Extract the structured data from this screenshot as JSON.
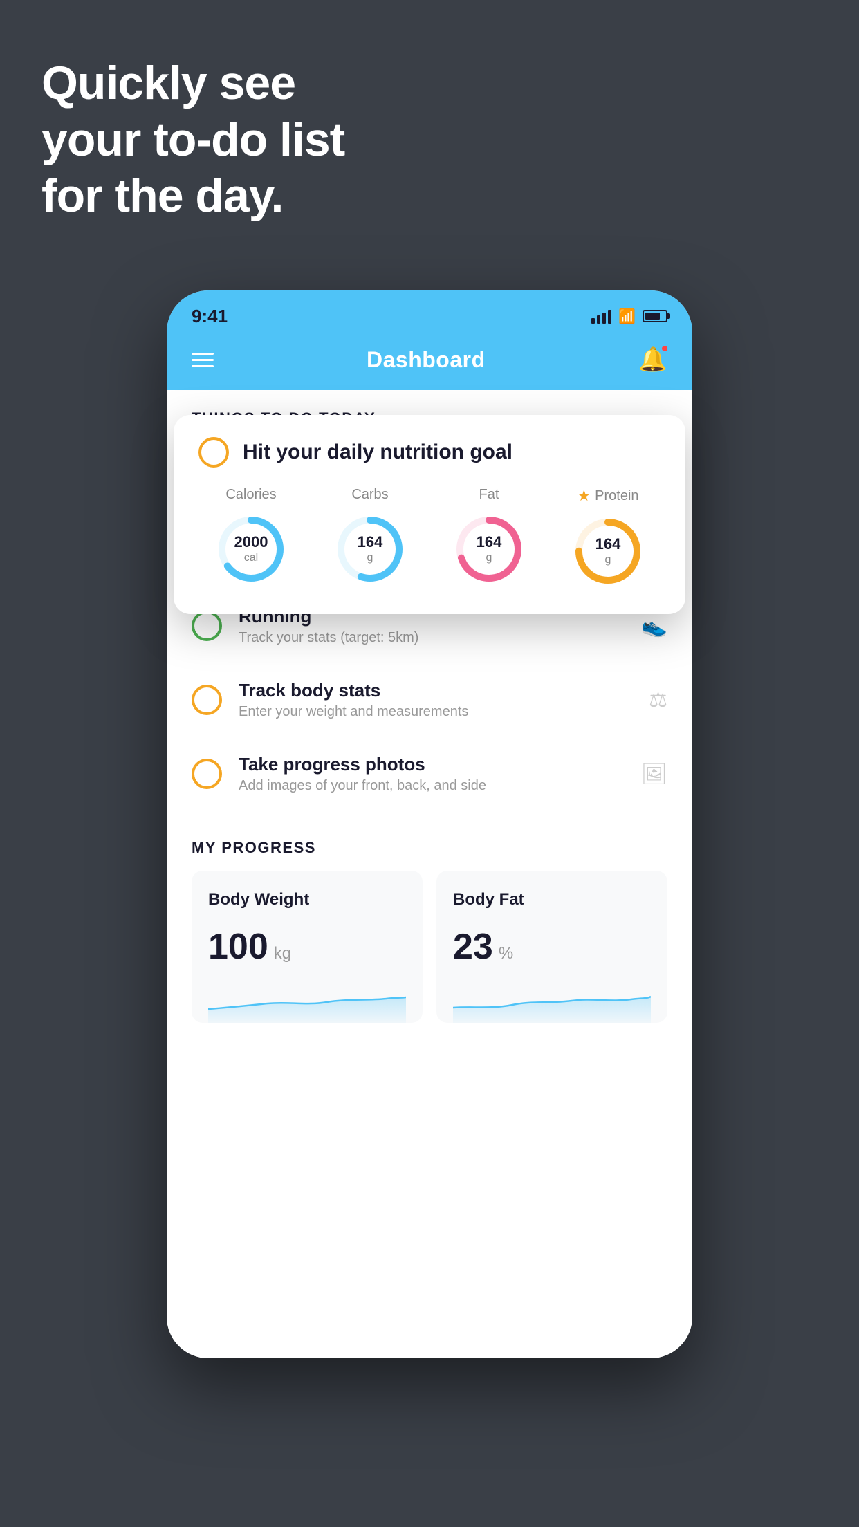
{
  "headline": {
    "line1": "Quickly see",
    "line2": "your to-do list",
    "line3": "for the day."
  },
  "status_bar": {
    "time": "9:41"
  },
  "header": {
    "title": "Dashboard"
  },
  "things_section": {
    "title": "THINGS TO DO TODAY"
  },
  "floating_card": {
    "title": "Hit your daily nutrition goal",
    "nutrients": [
      {
        "label": "Calories",
        "value": "2000",
        "unit": "cal",
        "color": "#4fc3f7",
        "track_color": "#e8f7fd",
        "percent": 65
      },
      {
        "label": "Carbs",
        "value": "164",
        "unit": "g",
        "color": "#4fc3f7",
        "track_color": "#e8f7fd",
        "percent": 55
      },
      {
        "label": "Fat",
        "value": "164",
        "unit": "g",
        "color": "#f06292",
        "track_color": "#fde8f0",
        "percent": 70
      },
      {
        "label": "Protein",
        "value": "164",
        "unit": "g",
        "color": "#f5a623",
        "track_color": "#fef3e2",
        "percent": 75,
        "starred": true
      }
    ]
  },
  "todo_items": [
    {
      "title": "Running",
      "subtitle": "Track your stats (target: 5km)",
      "checkbox": "green",
      "icon": "shoe"
    },
    {
      "title": "Track body stats",
      "subtitle": "Enter your weight and measurements",
      "checkbox": "yellow",
      "icon": "scale"
    },
    {
      "title": "Take progress photos",
      "subtitle": "Add images of your front, back, and side",
      "checkbox": "yellow",
      "icon": "photo"
    }
  ],
  "progress_section": {
    "title": "MY PROGRESS",
    "cards": [
      {
        "title": "Body Weight",
        "value": "100",
        "unit": "kg"
      },
      {
        "title": "Body Fat",
        "value": "23",
        "unit": "%"
      }
    ]
  }
}
